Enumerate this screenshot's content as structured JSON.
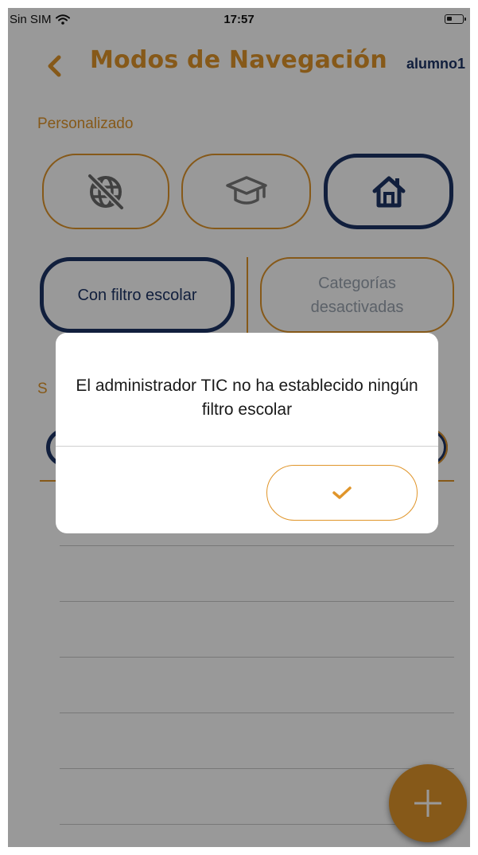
{
  "status_bar": {
    "carrier": "Sin SIM",
    "time": "17:57"
  },
  "header": {
    "title": "Modos de Navegación",
    "user": "alumno1"
  },
  "section": {
    "label": "Personalizado"
  },
  "modes": [
    {
      "icon": "globe-blocked-icon",
      "active": false
    },
    {
      "icon": "graduation-cap-icon",
      "active": false
    },
    {
      "icon": "home-icon",
      "active": true
    }
  ],
  "filters": {
    "school_filter_label": "Con filtro escolar",
    "categories_label": "Categorías desactivadas"
  },
  "partial_section": {
    "letter": "S"
  },
  "dialog": {
    "message": "El administrador TIC no ha establecido ningún filtro escolar",
    "confirm_icon": "checkmark-icon"
  },
  "fab": {
    "icon": "plus-icon"
  },
  "colors": {
    "accent": "#e0952a",
    "navy": "#1d3466",
    "overlay": "rgba(0,0,0,0.40)"
  }
}
